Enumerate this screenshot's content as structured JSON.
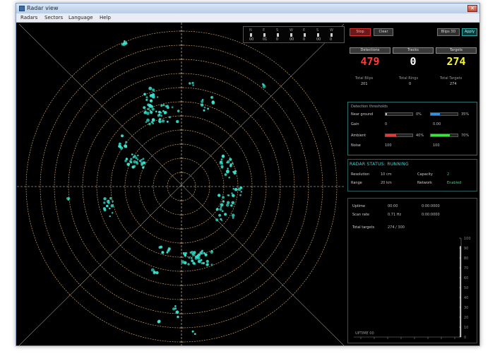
{
  "window": {
    "title": "Radar view",
    "close_label": "✕"
  },
  "menu": [
    "Radars",
    "Sectors",
    "Language",
    "Help"
  ],
  "mini_table": {
    "headers": [
      "N",
      "E",
      "S",
      "W",
      "E",
      "S",
      "W"
    ],
    "values": [
      "00",
      "01",
      "0",
      "00",
      "0",
      "00",
      "0"
    ]
  },
  "panel": {
    "record_button": "Stop",
    "clear_button": "Clear",
    "view_button": "Blips 3D",
    "apply_button": "Apply",
    "counters": [
      {
        "header": "Detections",
        "value": "479",
        "color": "#ff3b3b",
        "sub_label": "Total Blips",
        "sub_value": "201"
      },
      {
        "header": "Tracks",
        "value": "0",
        "color": "#ffffff",
        "sub_label": "Total Rings",
        "sub_value": "0"
      },
      {
        "header": "Targets",
        "value": "274",
        "color": "#f4f433",
        "sub_label": "Total Targets",
        "sub_value": "274"
      }
    ],
    "threshold_section": {
      "title": "Detection thresholds",
      "rows": [
        {
          "label": "Near ground",
          "left_value": "0",
          "mid_value": "0%",
          "right_value": "35%",
          "left_fill": 0.05,
          "right_fill": 0.35,
          "right_color": "#3a8fd8"
        },
        {
          "label": "Gain",
          "left_value": "0",
          "mid_value": "",
          "right_value": "0.00",
          "left_fill": 0,
          "right_fill": 0,
          "right_color": "#3a8fd8"
        },
        {
          "label": "Ambient",
          "left_value": "0",
          "mid_value": "40%",
          "right_value": "70%",
          "left_fill": 0.4,
          "right_fill": 0.7,
          "right_color": "#3fe03f",
          "left_color": "#e03a3a"
        },
        {
          "label": "Noise",
          "left_value": "100",
          "mid_value": "",
          "right_value": "100",
          "left_fill": 0,
          "right_fill": 0,
          "right_color": "#3fe03f"
        }
      ]
    },
    "status_title": "RADAR STATUS: RUNNING",
    "status_rows": [
      {
        "label": "Resolution",
        "value": "10 cm",
        "label2": "Capacity",
        "value2": "2"
      },
      {
        "label": "Range",
        "value": "20 km",
        "label2": "Network",
        "value2": "Enabled"
      }
    ],
    "graph_info": [
      {
        "label": "Uptime",
        "value": "00:00",
        "value2": "0:00:0000"
      },
      {
        "label": "Scan rate",
        "value": "0.71 Hz",
        "value2": "0:00:0000"
      },
      {
        "label": "Total targets",
        "value": "274 / 300",
        "value2": ""
      }
    ],
    "graph": {
      "y_ticks": [
        "100",
        "90",
        "80",
        "70",
        "60",
        "50",
        "40",
        "30",
        "20",
        "10",
        "0"
      ],
      "footer": "UPTIME 00",
      "bar_level": 0.92
    }
  },
  "scope": {
    "ring_color": "#c9a060",
    "line_color": "#e6e0c8",
    "dot_color": "#39e6d2"
  }
}
